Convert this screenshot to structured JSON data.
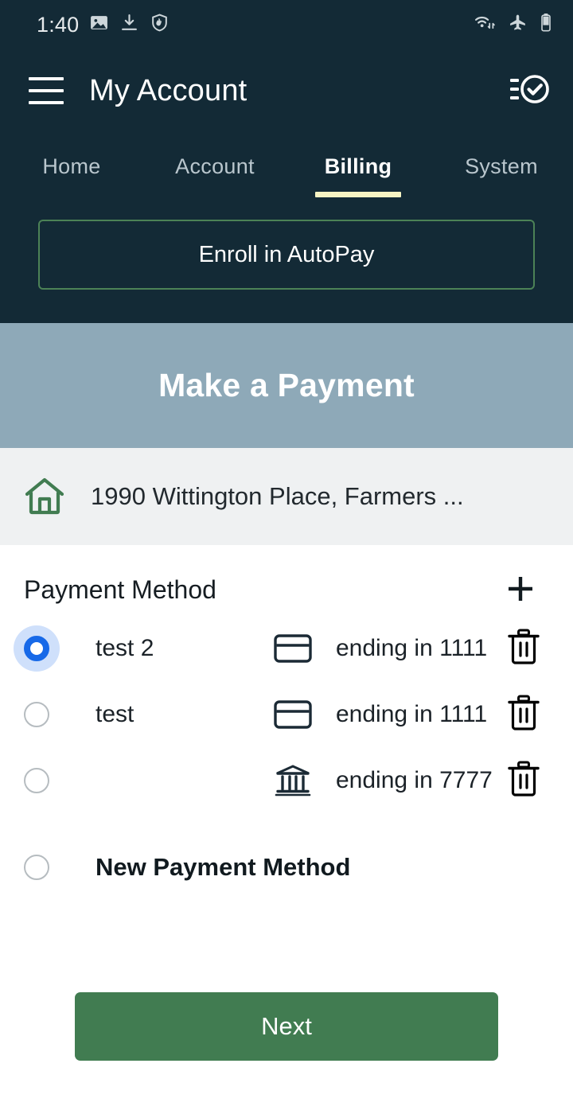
{
  "status_bar": {
    "time": "1:40",
    "left_icons": [
      "image-icon",
      "download-icon",
      "shield-hand-icon"
    ],
    "right_icons": [
      "wifi-data-icon",
      "airplane-mode-icon",
      "battery-icon"
    ]
  },
  "app_bar": {
    "menu_icon": "hamburger-menu-icon",
    "title": "My Account",
    "action_icon": "task-complete-icon"
  },
  "tabs": {
    "items": [
      {
        "label": "Home",
        "active": false
      },
      {
        "label": "Account",
        "active": false
      },
      {
        "label": "Billing",
        "active": true
      },
      {
        "label": "System",
        "active": false
      }
    ],
    "active_underline_color": "#f7f4c4"
  },
  "autopay": {
    "label": "Enroll in AutoPay",
    "border_color": "#4c8256"
  },
  "banner": {
    "title": "Make a Payment",
    "background_color": "#8ea9b8"
  },
  "address": {
    "icon": "home-icon",
    "icon_color": "#417c51",
    "text": "1990 Wittington Place, Farmers ..."
  },
  "payment_method": {
    "title": "Payment Method",
    "add_icon": "plus-icon",
    "rows": [
      {
        "nickname": "test 2",
        "type_icon": "credit-card-icon",
        "ending": "ending in 1111",
        "selected": true,
        "delete_icon": "trash-icon"
      },
      {
        "nickname": "test",
        "type_icon": "credit-card-icon",
        "ending": "ending in 1111",
        "selected": false,
        "delete_icon": "trash-icon"
      },
      {
        "nickname": "",
        "type_icon": "bank-icon",
        "ending": "ending in 7777",
        "selected": false,
        "delete_icon": "trash-icon"
      }
    ],
    "new_method": {
      "label": "New Payment Method",
      "selected": false
    },
    "selected_radio_color": "#1769e8"
  },
  "next_button": {
    "label": "Next",
    "background_color": "#417c51"
  }
}
